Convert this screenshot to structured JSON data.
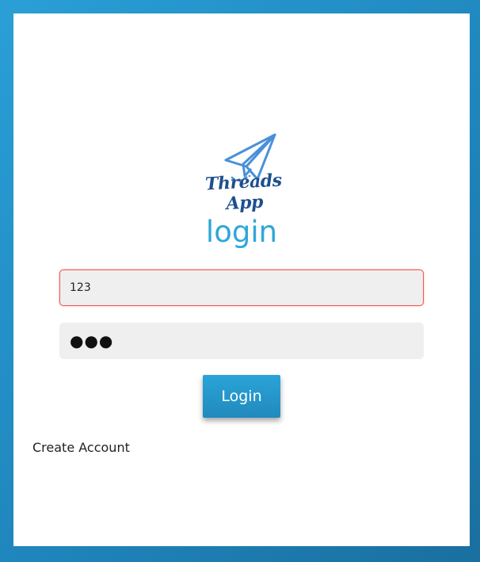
{
  "app": {
    "logo_name": "paper-plane-icon",
    "brand_text": "Threads App",
    "brand_color": "#1e4f8e",
    "accent_color": "#2fa7d8"
  },
  "login": {
    "title": "login",
    "username_value": "123",
    "password_value": "●●●",
    "submit_label": "Login",
    "create_account_label": "Create Account"
  },
  "colors": {
    "background": "#1f86bd",
    "field_background": "#f0efef",
    "error_border": "#ef5a5a",
    "button": "#2189bd"
  }
}
